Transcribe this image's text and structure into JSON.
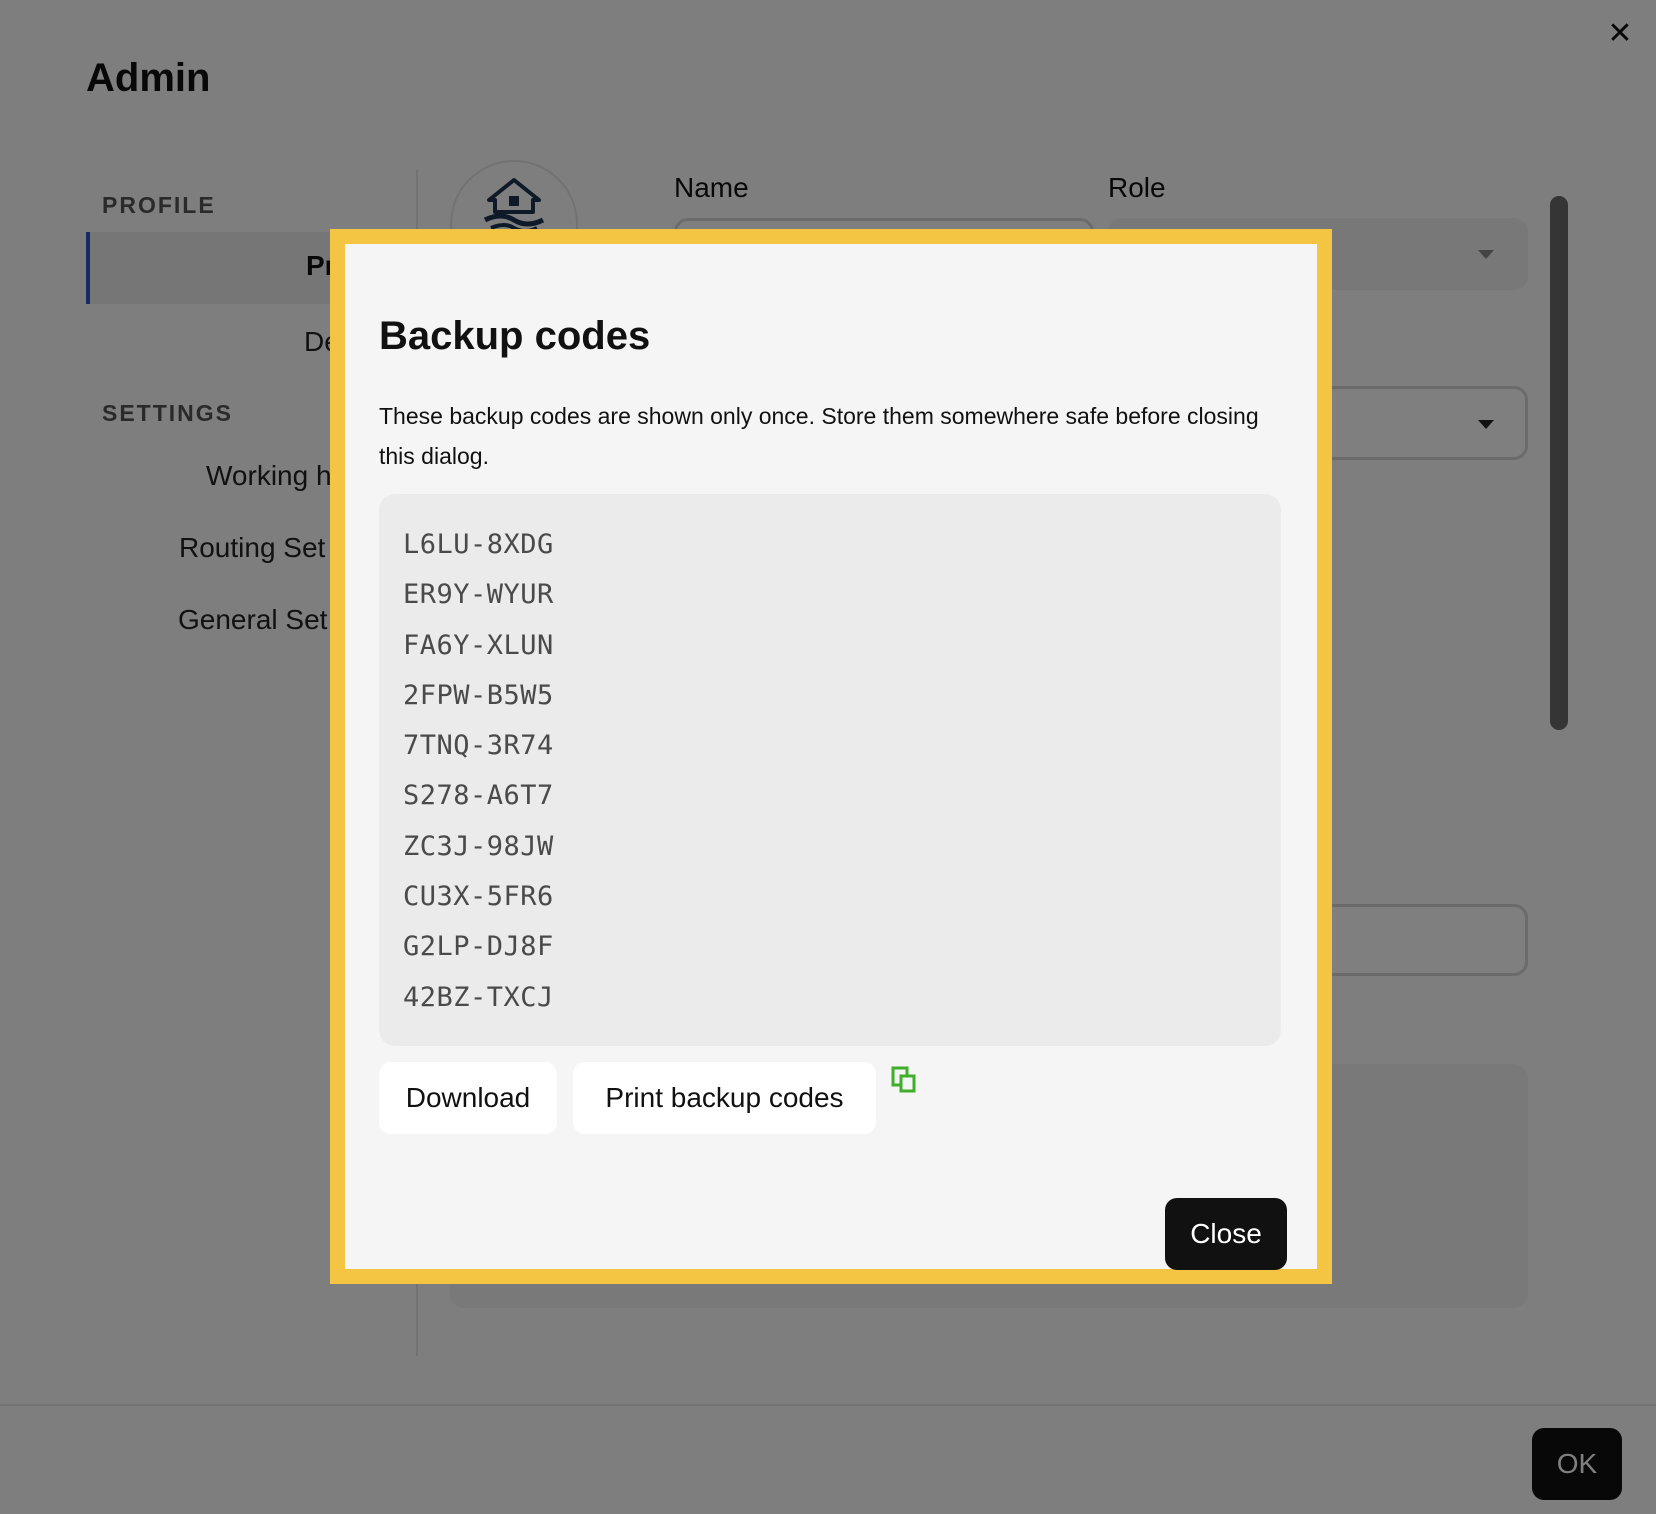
{
  "header": {
    "title": "Admin",
    "close_glyph": "✕"
  },
  "sidebar": {
    "profile_heading": "PROFILE",
    "profile_items": [
      {
        "label": "Pr",
        "active": true
      },
      {
        "label": "De"
      }
    ],
    "settings_heading": "SETTINGS",
    "settings_items": [
      {
        "label": "Working h"
      },
      {
        "label": "Routing Set"
      },
      {
        "label": "General Set"
      }
    ]
  },
  "form": {
    "name_label": "Name",
    "role_label": "Role",
    "avatar_icon": "house-logo-icon"
  },
  "footer": {
    "ok_label": "OK"
  },
  "modal": {
    "title": "Backup codes",
    "description": "These backup codes are shown only once. Store them somewhere safe before closing this dialog.",
    "codes": [
      "L6LU-8XDG",
      "ER9Y-WYUR",
      "FA6Y-XLUN",
      "2FPW-B5W5",
      "7TNQ-3R74",
      "S278-A6T7",
      "ZC3J-98JW",
      "CU3X-5FR6",
      "G2LP-DJ8F",
      "42BZ-TXCJ"
    ],
    "download_label": "Download",
    "print_label": "Print backup codes",
    "copy_icon": "copy-icon",
    "close_label": "Close"
  },
  "colors": {
    "modal_border": "#f4c542",
    "copy_icon": "#3fae2a",
    "active_nav_border": "#2c59c4"
  }
}
